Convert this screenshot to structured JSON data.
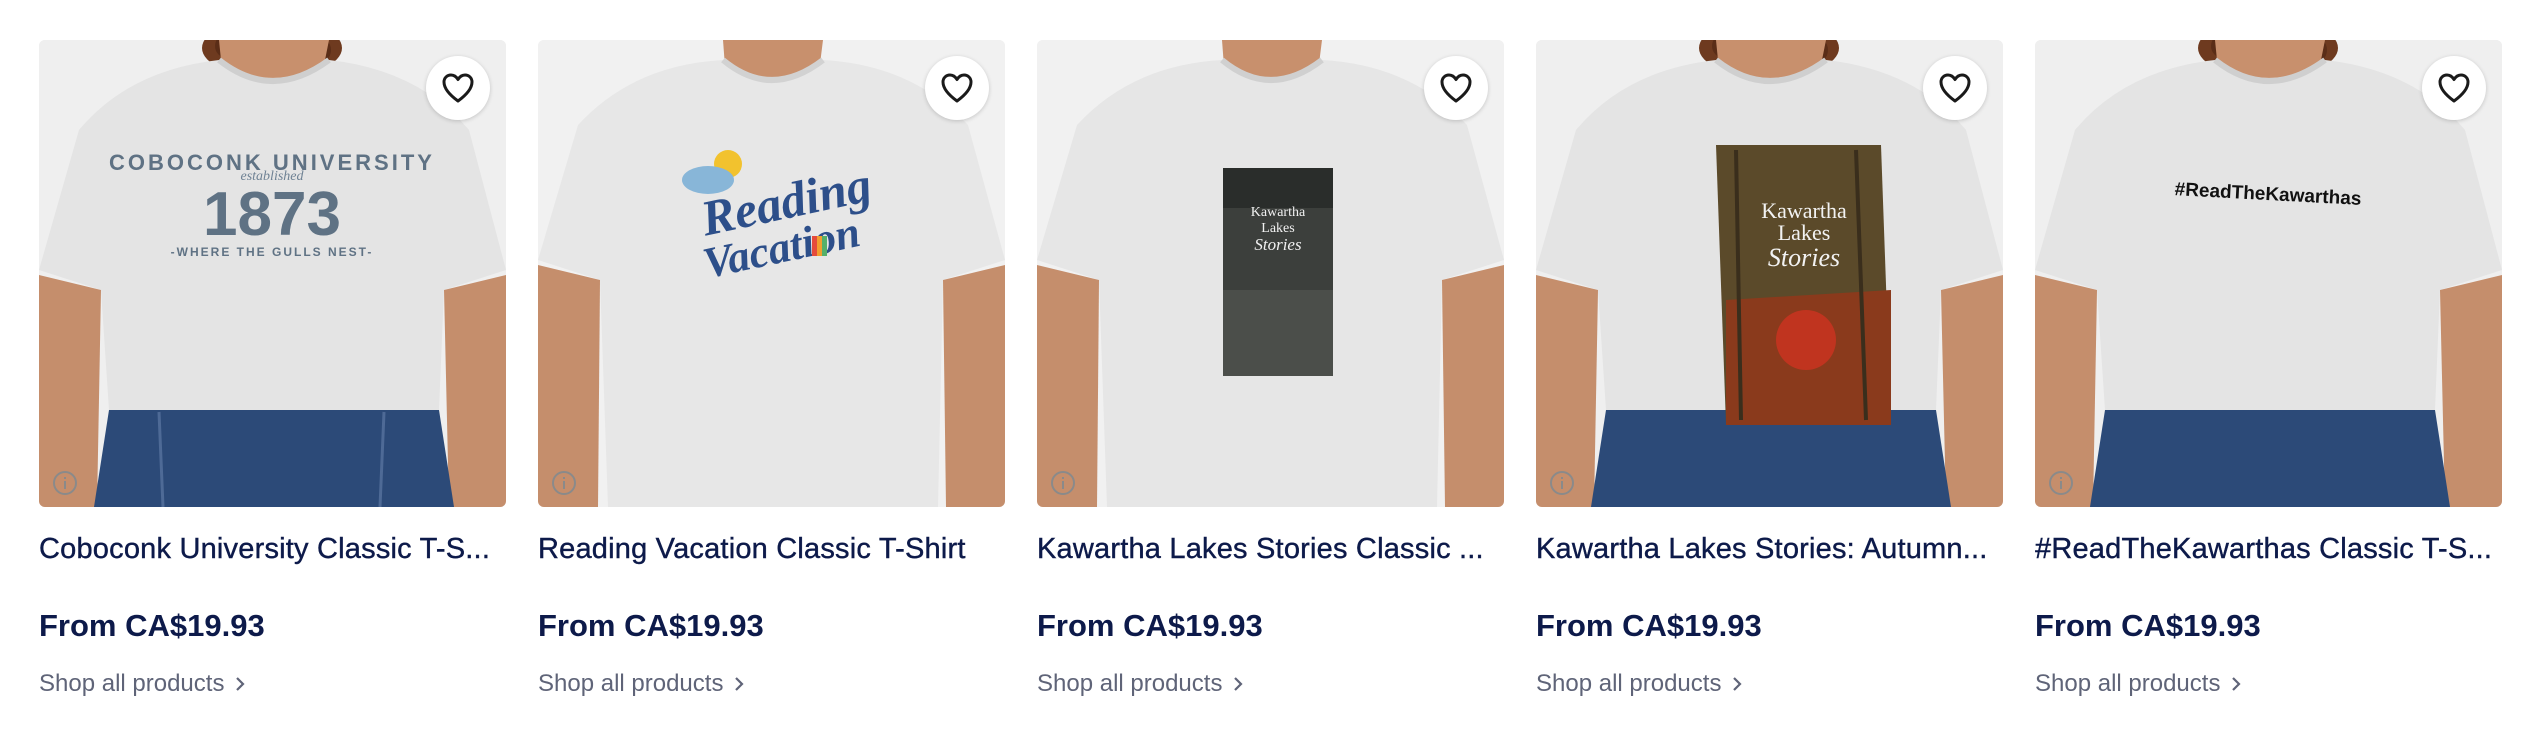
{
  "products": [
    {
      "title": "Coboconk University Classic T-S...",
      "price": "From CA$19.93",
      "link_label": "Shop all products",
      "design": "university",
      "design_text": {
        "line1": "COBOCONK UNIVERSITY",
        "line2": "established",
        "line3": "1873",
        "line4": "-WHERE THE GULLS NEST-"
      },
      "hair": true
    },
    {
      "title": "Reading Vacation Classic T-Shirt",
      "price": "From CA$19.93",
      "link_label": "Shop all products",
      "design": "reading",
      "design_text": {
        "line1": "Reading",
        "line2": "Vacation"
      },
      "hair": false
    },
    {
      "title": "Kawartha Lakes Stories Classic ...",
      "price": "From CA$19.93",
      "link_label": "Shop all products",
      "design": "kawartha-dark",
      "design_text": {
        "line1": "Kawartha",
        "line2": "Lakes",
        "line3": "Stories"
      },
      "hair": false
    },
    {
      "title": "Kawartha Lakes Stories: Autumn...",
      "price": "From CA$19.93",
      "link_label": "Shop all products",
      "design": "kawartha-autumn",
      "design_text": {
        "line1": "Kawartha",
        "line2": "Lakes",
        "line3": "Stories"
      },
      "hair": true
    },
    {
      "title": "#ReadTheKawarthas Classic T-S...",
      "price": "From CA$19.93",
      "link_label": "Shop all products",
      "design": "hashtag",
      "design_text": {
        "line1": "#ReadTheKawarthas"
      },
      "hair": true
    }
  ],
  "colors": {
    "title": "#0d1a4a",
    "link": "#5f6478",
    "shirt": "#e4e4e4",
    "jeans": "#2c4a78"
  }
}
